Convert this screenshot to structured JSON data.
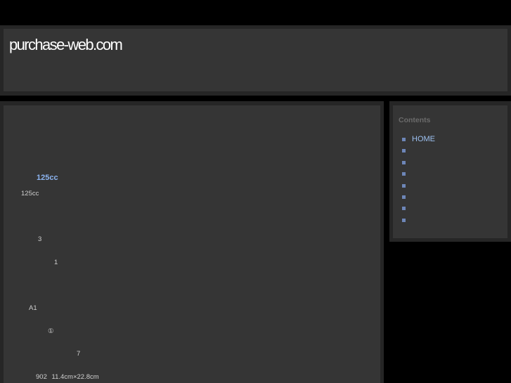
{
  "header": {
    "site_title": "purchase-web.com"
  },
  "article": {
    "title": "125cc",
    "lines": [
      "125cc",
      "3",
      "1",
      "A1",
      "①",
      "7",
      "902 11.4cm×22.8cm"
    ]
  },
  "sidebar": {
    "heading": "Contents",
    "items": [
      {
        "label": "HOME"
      },
      {
        "label": ""
      },
      {
        "label": ""
      },
      {
        "label": ""
      },
      {
        "label": ""
      },
      {
        "label": ""
      },
      {
        "label": ""
      },
      {
        "label": ""
      }
    ]
  },
  "colors": {
    "background": "#000000",
    "panel_border": "#262626",
    "panel": "#353535",
    "link": "#9cc0f0",
    "bullet": "#6d86b8"
  }
}
